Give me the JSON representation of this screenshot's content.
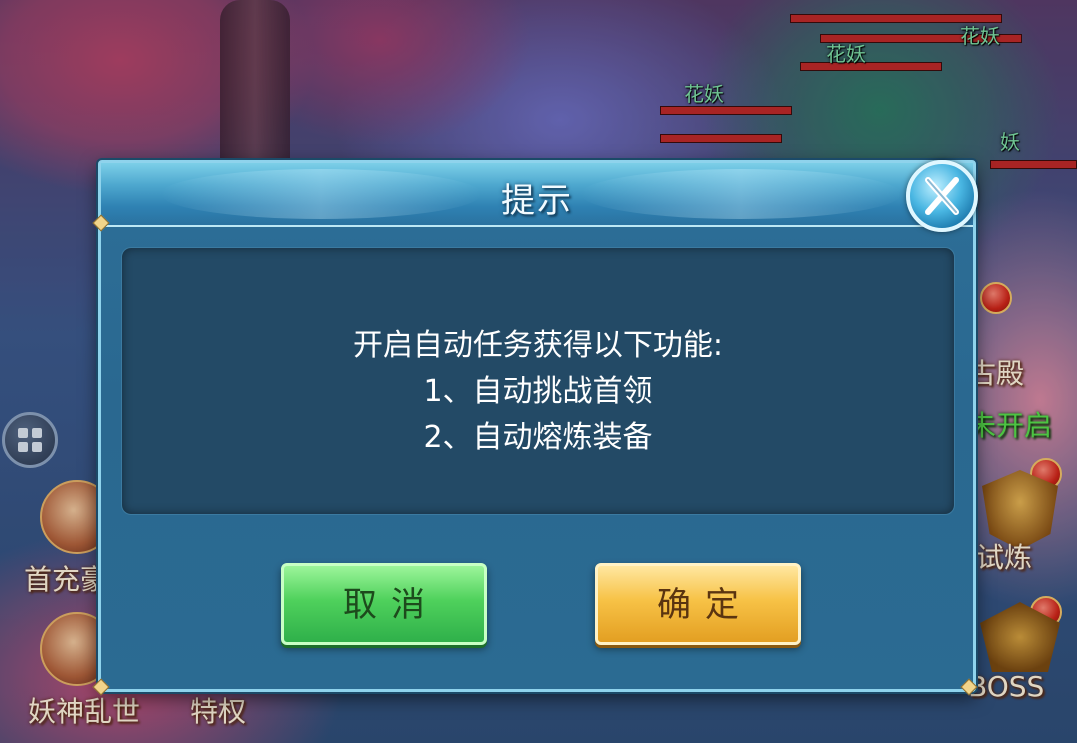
{
  "dialog": {
    "title": "提示",
    "message_lines": [
      "开启自动任务获得以下功能:",
      "1、自动挑战首领",
      "2、自动熔炼装备"
    ],
    "cancel_label": "取消",
    "confirm_label": "确定",
    "close_icon": "close-x-icon"
  },
  "background": {
    "enemy_names": [
      "花妖",
      "花妖",
      "花妖",
      "妖"
    ],
    "left_labels": [
      "首充豪",
      "妖神乱世",
      "特权"
    ],
    "right_labels": [
      "古殿",
      "未开启",
      "试炼",
      "BOSS"
    ]
  },
  "colors": {
    "dialog_frame": "#2b6b92",
    "panel": "#234a66",
    "cancel_green": "#4fd15c",
    "confirm_gold": "#f7c246",
    "enemy_name_green": "#7fe0a8",
    "unlock_green": "#57e04c"
  }
}
